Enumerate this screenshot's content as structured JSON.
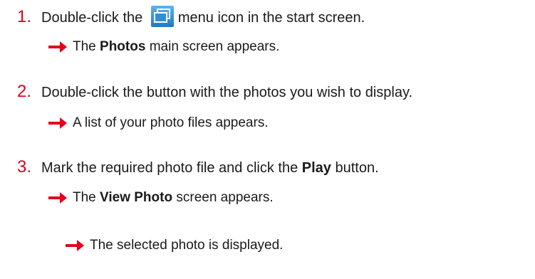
{
  "colors": {
    "step_number": "#e0001a",
    "arrow": "#e0001a",
    "icon_bg": "#2f8fd8"
  },
  "steps": [
    {
      "number": "1.",
      "text_before": "Double-click the",
      "icon": "windows-menu-icon",
      "text_after": "menu icon in the start screen."
    },
    {
      "number": "2.",
      "text": "Double-click the button with the photos you wish to display."
    },
    {
      "number": "3.",
      "text_before": "Mark the required photo file and click the",
      "bold": "Play",
      "text_after": "button."
    }
  ],
  "results": [
    {
      "pre": "The",
      "bold": "Photos",
      "post": "main screen appears."
    },
    {
      "text": "A list of your photo files appears."
    },
    {
      "pre": "The",
      "bold": "View Photo",
      "post": "screen appears."
    },
    {
      "text": "The selected photo is displayed."
    }
  ]
}
